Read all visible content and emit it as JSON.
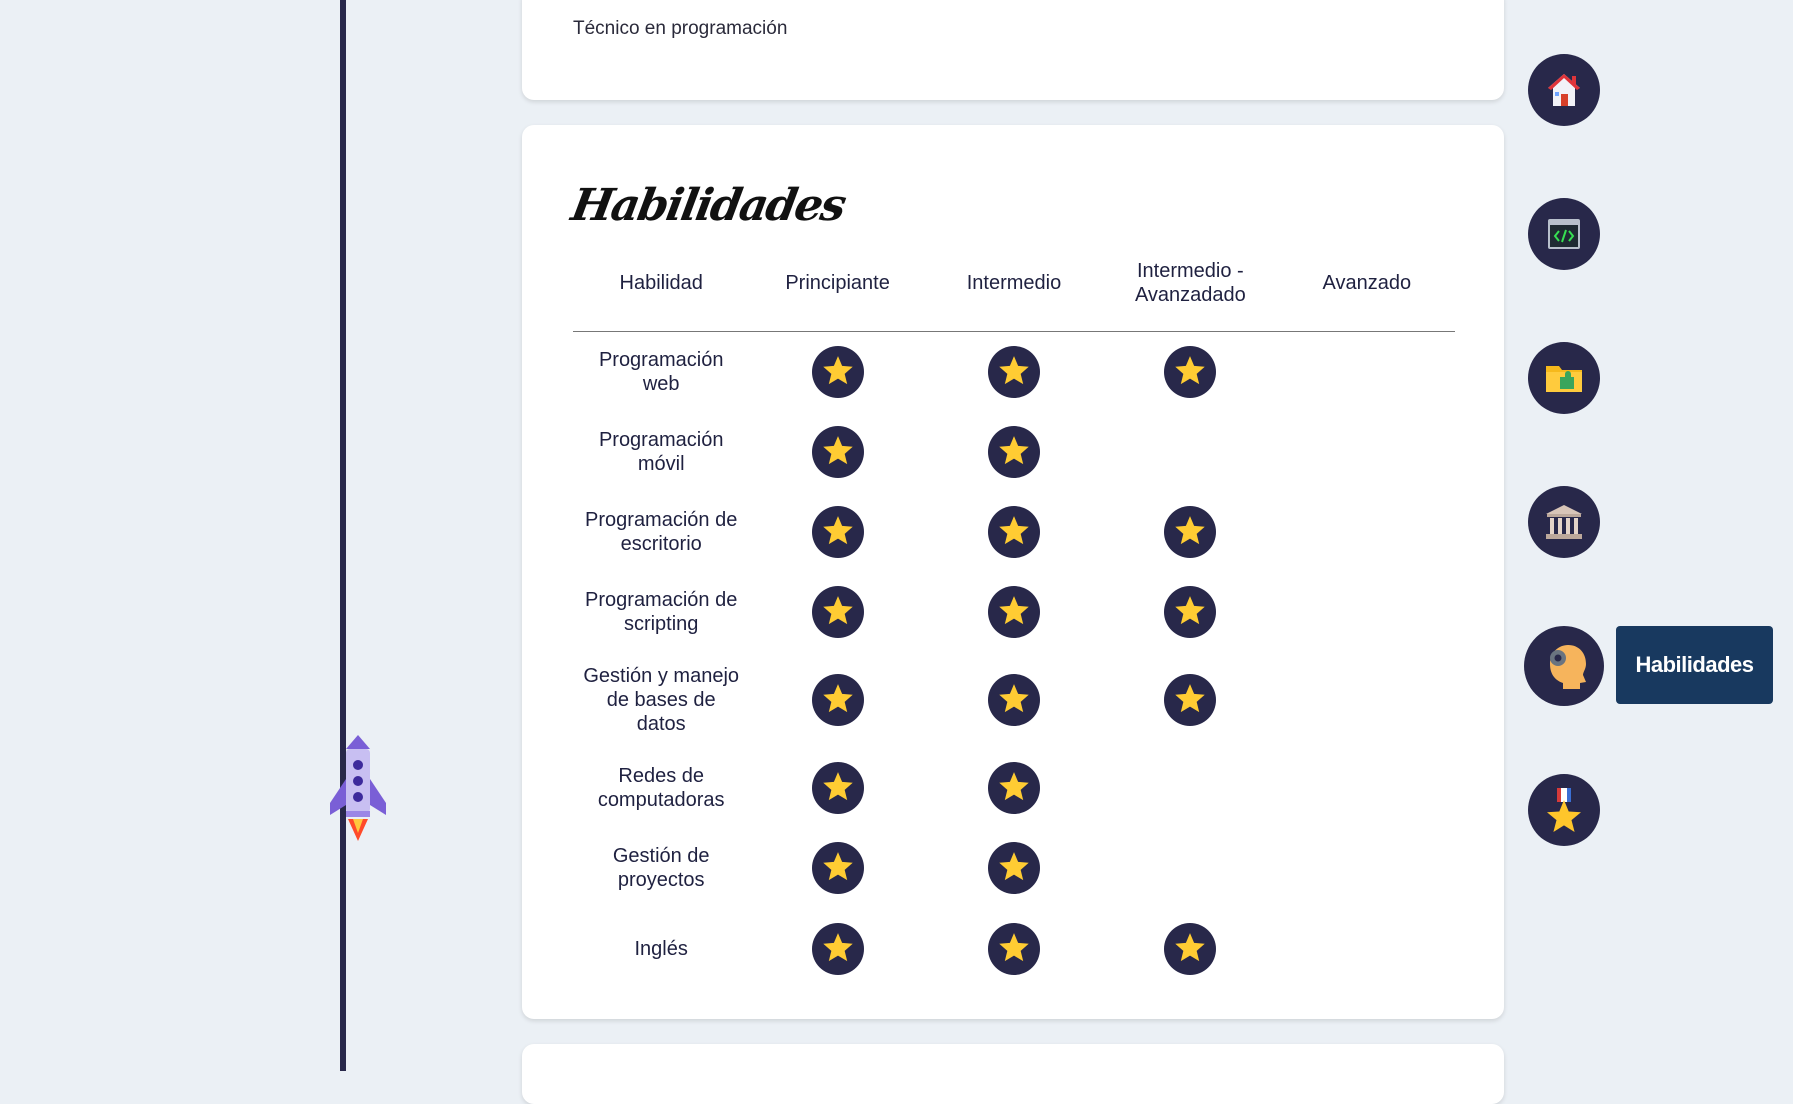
{
  "education": {
    "degree": "Técnico en programación"
  },
  "skills_section": {
    "title": "Habilidades",
    "columns": [
      "Habilidad",
      "Principiante",
      "Intermedio",
      "Intermedio - Avanzadado",
      "Avanzado"
    ],
    "rows": [
      {
        "name": "Programación web",
        "level": 3
      },
      {
        "name": "Programación móvil",
        "level": 2
      },
      {
        "name": "Programación de escritorio",
        "level": 3
      },
      {
        "name": "Programación de scripting",
        "level": 3
      },
      {
        "name": "Gestión y manejo de bases de datos",
        "level": 3
      },
      {
        "name": "Redes de computadoras",
        "level": 2
      },
      {
        "name": "Gestión de proyectos",
        "level": 2
      },
      {
        "name": "Inglés",
        "level": 3
      }
    ]
  },
  "nav": {
    "items": [
      {
        "icon": "house-icon"
      },
      {
        "icon": "code-window-icon"
      },
      {
        "icon": "folder-puzzle-icon"
      },
      {
        "icon": "institution-icon"
      },
      {
        "icon": "head-gear-icon",
        "active": true
      },
      {
        "icon": "medal-icon"
      }
    ],
    "tooltip": "Habilidades"
  },
  "colors": {
    "background": "#ebf0f5",
    "card": "#ffffff",
    "navy": "#28284a",
    "star": "#ffcc33",
    "tooltip_bg": "#18395f"
  }
}
